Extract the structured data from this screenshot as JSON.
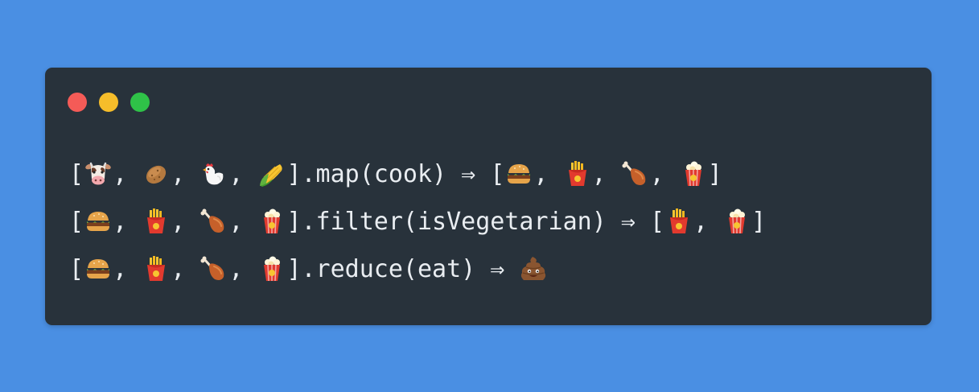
{
  "window": {
    "traffic_lights": [
      "#f45b57",
      "#f6bd2a",
      "#2fc248"
    ],
    "background": "#28323b"
  },
  "code_lines": [
    {
      "input": [
        "cow",
        "potato",
        "chicken",
        "corn"
      ],
      "method": "map",
      "arg": "cook",
      "arrow": "⇒",
      "output": [
        "hamburger",
        "fries",
        "poultry-leg",
        "popcorn"
      ]
    },
    {
      "input": [
        "hamburger",
        "fries",
        "poultry-leg",
        "popcorn"
      ],
      "method": "filter",
      "arg": "isVegetarian",
      "arrow": "⇒",
      "output": [
        "fries",
        "popcorn"
      ]
    },
    {
      "input": [
        "hamburger",
        "fries",
        "poultry-leg",
        "popcorn"
      ],
      "method": "reduce",
      "arg": "eat",
      "arrow": "⇒",
      "result": "poo"
    }
  ],
  "syntax": {
    "open_bracket": "[",
    "close_bracket": "]",
    "comma": ", ",
    "dot": ".",
    "open_paren": "(",
    "close_paren": ")"
  }
}
